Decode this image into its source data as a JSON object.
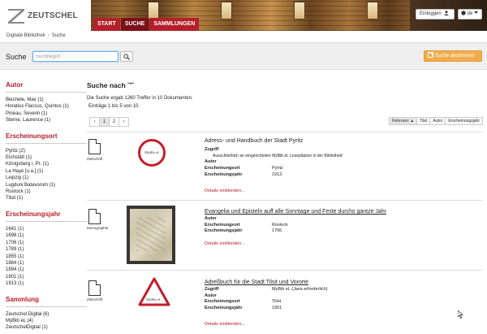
{
  "app": {
    "logo_text": "ZEUTSCHEL",
    "nav": [
      {
        "label": "START"
      },
      {
        "label": "SUCHE"
      },
      {
        "label": "SAMMLUNGEN"
      }
    ],
    "login_label": "Einloggen",
    "lang_label": "de"
  },
  "breadcrumb": {
    "root": "Digitale Bibliothek",
    "current": "Suche"
  },
  "search": {
    "label": "Suche",
    "placeholder": "Suchbegriff",
    "subscribe_label": "Suche abonnieren"
  },
  "sidebar": {
    "autor": {
      "title": "Autor",
      "items": [
        "Biechele, Max (1)",
        "Horatius Flaccus, Quintus (1)",
        "Pineau, Severin (1)",
        "Sterne, Laurence (1)"
      ]
    },
    "ort": {
      "title": "Erscheinungsort",
      "items": [
        "Pyritz (2)",
        "Eichstätt (1)",
        "Königsberg i. Pr. (1)",
        "La Haye [u.a.] (1)",
        "Leipzig (1)",
        "Lugduni Batavorum (1)",
        "Rostock (1)",
        "Tilsit (1)"
      ]
    },
    "jahr": {
      "title": "Erscheinungsjahr",
      "items": [
        "1641 (1)",
        "1698 (1)",
        "1706 (1)",
        "1789 (1)",
        "1855 (1)",
        "1884 (1)",
        "1894 (1)",
        "1901 (1)",
        "1913 (1)"
      ]
    },
    "sammlung": {
      "title": "Sammlung",
      "items": [
        "Zeutschel Digital (6)",
        "MyBib eL (4)",
        "ZeutschelDigital (1)"
      ]
    }
  },
  "main": {
    "title": "Suche nach",
    "query": "\"*\"",
    "summary": "Die Suche ergab 1260 Treffer in 10 Dokumenten.",
    "entries": "Einträge 1 bis 5 von 10.",
    "pager": [
      "‹",
      "1",
      "2",
      "›"
    ],
    "sort": [
      "Relevanz ▲",
      "Titel",
      "Autor",
      "Erscheinungsjahr"
    ],
    "records": [
      {
        "type": "Zeitschrift",
        "title": "Adress- und Handbuch der Stadt Pyritz",
        "thumb_label": "MyBib eL",
        "zugriff_label": "Zugriff",
        "zugriff_note": "Ausschließlich an eingerichteten MyBib eL Leseplätzen in der Bibliothek!",
        "autor_label": "Autor",
        "ort_label": "Erscheinungsort",
        "ort": "Pyritz",
        "jahr_label": "Erscheinungsjahr",
        "jahr": "1913",
        "details": "Details einblenden..."
      },
      {
        "type": "Monographie",
        "title": "Evangelia und Episteln auff alle Sonntage und Feste durchs gantze Jahr",
        "autor_label": "Autor",
        "ort_label": "Erscheinungsort",
        "ort": "Rostock",
        "jahr_label": "Erscheinungsjahr",
        "jahr": "1706",
        "details": "Details einblenden..."
      },
      {
        "type": "Zeitschrift",
        "title": "Adreßbuch für die Stadt Tilsit und Vororte",
        "thumb_label": "MyBib eL",
        "zugriff_label": "Zugriff",
        "zugriff": "MyBib eL (Java erforderlich)",
        "autor_label": "Autor",
        "ort_label": "Erscheinungsort",
        "ort": "Tilsit",
        "jahr_label": "Erscheinungsjahr",
        "jahr": "1901",
        "details": "Details einblenden..."
      }
    ]
  },
  "colors": {
    "brand_red": "#b3202a",
    "nav_active": "#7a1118",
    "subscribe": "#f0ad4e"
  }
}
